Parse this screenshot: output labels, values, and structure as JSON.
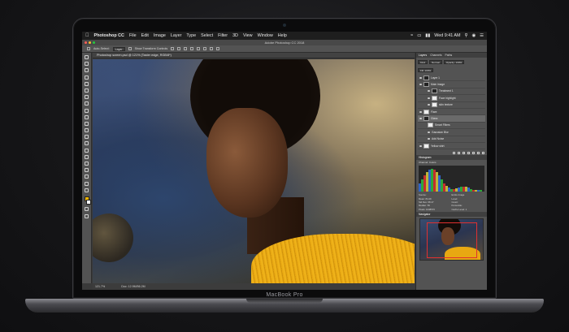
{
  "menubar": {
    "app_name": "Photoshop CC",
    "items": [
      "File",
      "Edit",
      "Image",
      "Layer",
      "Type",
      "Select",
      "Filter",
      "3D",
      "View",
      "Window",
      "Help"
    ],
    "clock": "Wed 9:41 AM"
  },
  "window": {
    "title": "Adobe Photoshop CC 2018",
    "document_tab": "Photoshop screen.psd @ 121% (Taster edge, RGB/8*)"
  },
  "options_bar": {
    "auto_select_label": "Auto-Select:",
    "auto_select_value": "Layer",
    "show_transform_label": "Show Transform Controls"
  },
  "status_bar": {
    "zoom": "121.7%",
    "info": "Doc: 12.9M/56.2M"
  },
  "layers_panel": {
    "tabs": [
      "Layers",
      "Channels",
      "Paths"
    ],
    "kind_filter": "Kind",
    "blend_mode": "Normal",
    "opacity": "Opacity: 100%",
    "fill": "Fill: 100%",
    "layers": [
      {
        "name": "Layer 1",
        "selected": false
      },
      {
        "name": "Main image",
        "selected": false
      },
      {
        "name": "Treatment 1",
        "selected": false
      },
      {
        "name": "Face highlight",
        "selected": false
      },
      {
        "name": "skin texture",
        "selected": false
      },
      {
        "name": "Flare",
        "selected": false
      },
      {
        "name": "Glass",
        "selected": true
      },
      {
        "name": "Smart Filters",
        "selected": false
      },
      {
        "name": "Gaussian Blur",
        "selected": false
      },
      {
        "name": "Add Noise",
        "selected": false
      },
      {
        "name": "Yellow shirt",
        "selected": false
      }
    ]
  },
  "histogram": {
    "title": "Histogram",
    "channel_label": "Channel:",
    "channel": "Colors",
    "source_label": "Source:",
    "source": "Entire Image",
    "stats": [
      "Mean: 84.29",
      "Level:",
      "Std Dev: 68.47",
      "Count:",
      "Median: 59",
      "Percentile:",
      "Pixels: 1048576",
      "Cache Level: 1"
    ],
    "colors": {
      "red": "#e03030",
      "green": "#30c040",
      "blue": "#3070e8",
      "yellow": "#d8d040"
    }
  },
  "navigator": {
    "title": "Navigator"
  },
  "device": {
    "label": "MacBook Pro"
  }
}
